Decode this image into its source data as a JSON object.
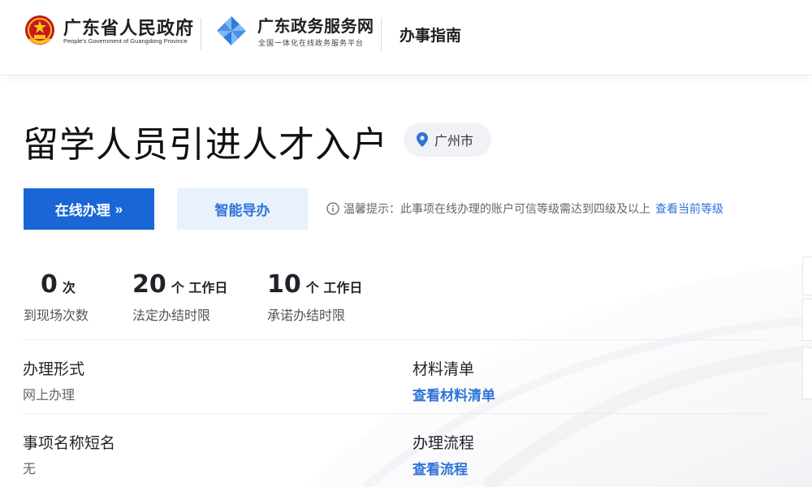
{
  "header": {
    "gov_name": "广东省人民政府",
    "gov_sub": "People's Government of Guangdong Province",
    "svc_name": "广东政务服务网",
    "svc_sub": "全国一体化在线政务服务平台",
    "guide": "办事指南"
  },
  "item": {
    "title": "留学人员引进人才入户",
    "location": "广州市"
  },
  "actions": {
    "online_label": "在线办理",
    "online_chevron": "»",
    "guide_label": "智能导办"
  },
  "tip": {
    "text": "温馨提示：此事项在线办理的账户可信等级需达到四级及以上",
    "link": "查看当前等级"
  },
  "stats": [
    {
      "num": "0",
      "unit": "次",
      "label": "到现场次数"
    },
    {
      "num": "20",
      "unit": "个 工作日",
      "label": "法定办结时限"
    },
    {
      "num": "10",
      "unit": "个 工作日",
      "label": "承诺办结时限"
    }
  ],
  "info": {
    "form_key": "办理形式",
    "form_val": "网上办理",
    "materials_key": "材料清单",
    "materials_link": "查看材料清单",
    "short_name_key": "事项名称短名",
    "short_name_val": "无",
    "process_key": "办理流程",
    "process_link": "查看流程"
  },
  "colors": {
    "primary": "#1a66d6",
    "secondary_bg": "#e8f1fc",
    "link": "#2f73d8",
    "emblem_red": "#c8161d",
    "emblem_gold": "#f5c518",
    "pinwheel_blue": "#2b7de0"
  }
}
